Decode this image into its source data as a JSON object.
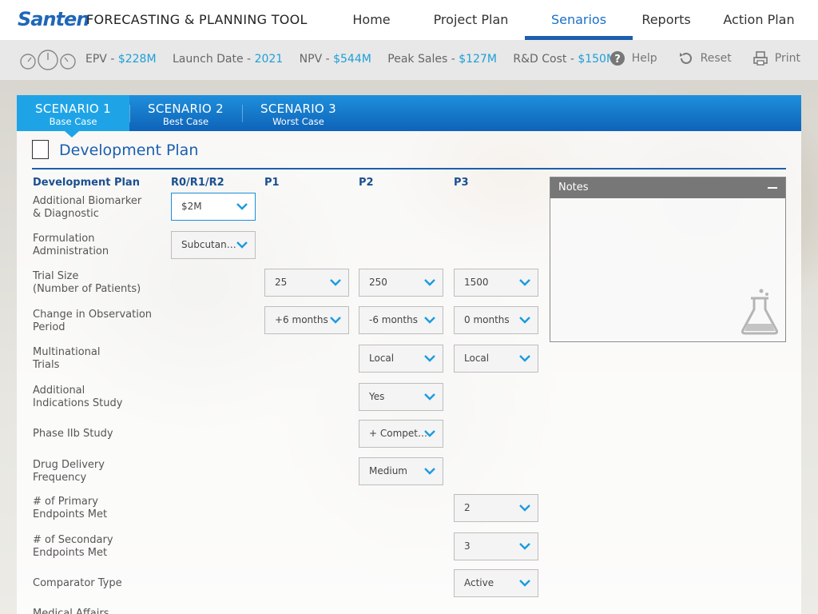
{
  "brand": {
    "logo_text": "Santen",
    "app_title": "FORECASTING & PLANNING TOOL"
  },
  "nav": [
    {
      "label": "Home",
      "active": false
    },
    {
      "label": "Project Plan",
      "active": false
    },
    {
      "label": "Senarios",
      "active": true
    },
    {
      "label": "Reports",
      "active": false
    },
    {
      "label": "Action Plan",
      "active": false
    }
  ],
  "metrics": {
    "epv_label": "EPV - ",
    "epv_value": "$228M",
    "launch_label": "Launch Date - ",
    "launch_value": "2021",
    "npv_label": "NPV - ",
    "npv_value": "$544M",
    "peak_label": "Peak Sales - ",
    "peak_value": "$127M",
    "rd_label": "R&D Cost - ",
    "rd_value": "$150M"
  },
  "tools": {
    "help": "Help",
    "reset": "Reset",
    "print": "Print"
  },
  "scenarios": [
    {
      "title": "SCENARIO 1",
      "subtitle": "Base Case",
      "active": true
    },
    {
      "title": "SCENARIO 2",
      "subtitle": "Best Case",
      "active": false
    },
    {
      "title": "SCENARIO 3",
      "subtitle": "Worst Case",
      "active": false
    }
  ],
  "section": {
    "title": "Development Plan"
  },
  "columns": {
    "label": "Development Plan",
    "r0": "R0/R1/R2",
    "p1": "P1",
    "p2": "P2",
    "p3": "P3"
  },
  "rows": [
    {
      "label": "Additional Biomarker\n& Diagnostic",
      "r0": "$2M"
    },
    {
      "label": "Formulation\nAdministration",
      "r0": "Subcutane..."
    },
    {
      "label": "Trial Size\n(Number of Patients)",
      "p1": "25",
      "p2": "250",
      "p3": "1500"
    },
    {
      "label": "Change in Observation\nPeriod",
      "p1": "+6 months",
      "p2": "-6 months",
      "p3": "0 months"
    },
    {
      "label": "Multinational\nTrials",
      "p2": "Local",
      "p3": "Local"
    },
    {
      "label": "Additional\nIndications Study",
      "p2": "Yes"
    },
    {
      "label": "Phase IIb Study",
      "p2": "+ Competi..."
    },
    {
      "label": "Drug Delivery\nFrequency",
      "p2": "Medium"
    },
    {
      "label": "# of Primary\nEndpoints Met",
      "p3": "2"
    },
    {
      "label": "# of Secondary\nEndpoints Met",
      "p3": "3"
    },
    {
      "label": "Comparator Type",
      "p3": "Active"
    },
    {
      "label": "Medical Affairs"
    }
  ],
  "notes": {
    "title": "Notes"
  },
  "colors": {
    "accent": "#1b6fc8",
    "value": "#1d9fd8",
    "tab_active": "#1ea4e6"
  }
}
